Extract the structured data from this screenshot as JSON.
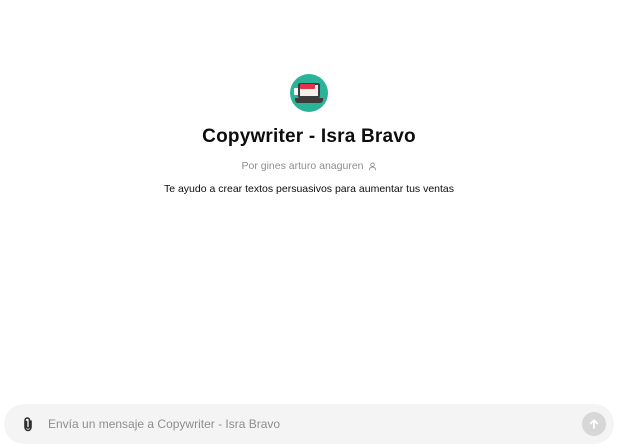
{
  "gpt": {
    "name": "Copywriter - Isra Bravo",
    "author": "Por gines arturo anaguren",
    "description": "Te ayudo a crear textos persuasivos para aumentar tus ventas",
    "avatar_icon": "laptop-illustration"
  },
  "composer": {
    "placeholder": "Envía un mensaje a Copywriter - Isra Bravo",
    "value": "",
    "attach_icon": "paperclip-icon",
    "send_icon": "arrow-up-icon"
  },
  "colors": {
    "avatar_bg": "#2bb39a",
    "composer_bg": "#f4f4f4",
    "send_disabled": "#d7d7d7",
    "muted_text": "#8e8e8e"
  }
}
